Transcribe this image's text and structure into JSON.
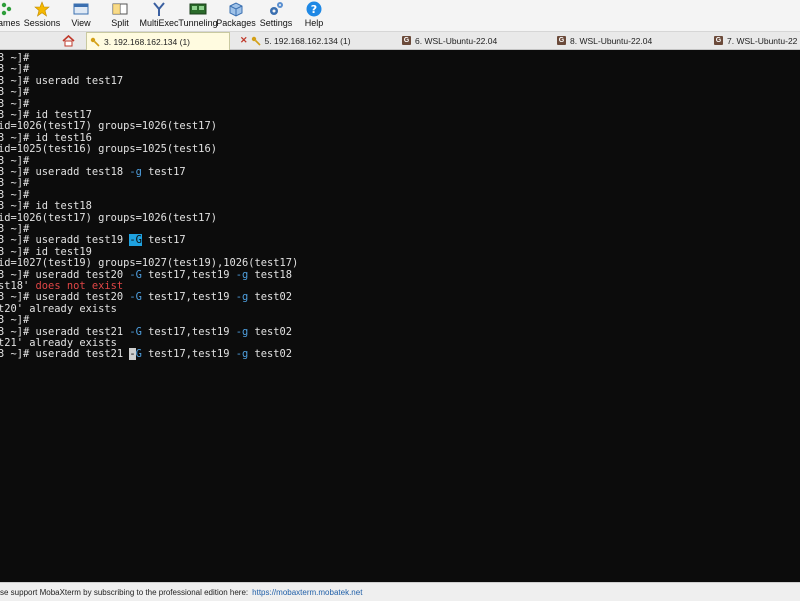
{
  "toolbar": {
    "items": [
      {
        "label": "ames",
        "icon": "games-icon"
      },
      {
        "label": "Sessions",
        "icon": "star-icon"
      },
      {
        "label": "View",
        "icon": "view-icon"
      },
      {
        "label": "Split",
        "icon": "split-icon"
      },
      {
        "label": "MultiExec",
        "icon": "multiexec-icon"
      },
      {
        "label": "Tunneling",
        "icon": "tunneling-icon"
      },
      {
        "label": "Packages",
        "icon": "packages-icon"
      },
      {
        "label": "Settings",
        "icon": "settings-icon"
      },
      {
        "label": "Help",
        "icon": "help-icon"
      }
    ]
  },
  "tabs": [
    {
      "label": "3. 192.168.162.134 (1)",
      "active": true
    },
    {
      "label": "5. 192.168.162.134 (1)",
      "active": false
    },
    {
      "label": "6. WSL-Ubuntu-22.04",
      "active": false
    },
    {
      "label": "8. WSL-Ubuntu-22.04",
      "active": false
    },
    {
      "label": "7. WSL-Ubuntu-22",
      "active": false
    }
  ],
  "terminal": {
    "lines": [
      [
        [
          "3 ~]#",
          ""
        ]
      ],
      [
        [
          "3 ~]#",
          ""
        ]
      ],
      [
        [
          "3 ~]# useradd test17",
          ""
        ]
      ],
      [
        [
          "3 ~]#",
          ""
        ]
      ],
      [
        [
          "3 ~]#",
          ""
        ]
      ],
      [
        [
          "3 ~]# id test17",
          ""
        ]
      ],
      [
        [
          "id=1026(test17) groups=1026(test17)",
          ""
        ]
      ],
      [
        [
          "3 ~]# id test16",
          ""
        ]
      ],
      [
        [
          "id=1025(test16) groups=1025(test16)",
          ""
        ]
      ],
      [
        [
          "3 ~]#",
          ""
        ]
      ],
      [
        [
          "3 ~]# useradd test18 ",
          ""
        ],
        [
          "-g",
          "opt"
        ],
        [
          " test17",
          ""
        ]
      ],
      [
        [
          "3 ~]#",
          ""
        ]
      ],
      [
        [
          "3 ~]#",
          ""
        ]
      ],
      [
        [
          "3 ~]# id test18",
          ""
        ]
      ],
      [
        [
          "id=1026(test17) groups=1026(test17)",
          ""
        ]
      ],
      [
        [
          "3 ~]#",
          ""
        ]
      ],
      [
        [
          "3 ~]# useradd test19 ",
          ""
        ],
        [
          "-G",
          "hl"
        ],
        [
          " test17",
          ""
        ]
      ],
      [
        [
          "3 ~]# id test19",
          ""
        ]
      ],
      [
        [
          "id=1027(test19) groups=1027(test19),1026(test17)",
          ""
        ]
      ],
      [
        [
          "3 ~]# useradd test20 ",
          ""
        ],
        [
          "-G",
          "opt"
        ],
        [
          " test17,test19 ",
          ""
        ],
        [
          "-g",
          "opt"
        ],
        [
          " test18",
          ""
        ]
      ],
      [
        [
          "st18' ",
          ""
        ],
        [
          "does not exist",
          "err"
        ]
      ],
      [
        [
          "3 ~]# useradd test20 ",
          ""
        ],
        [
          "-G",
          "opt"
        ],
        [
          " test17,test19 ",
          ""
        ],
        [
          "-g",
          "opt"
        ],
        [
          " test02",
          ""
        ]
      ],
      [
        [
          "t20' already exists",
          ""
        ]
      ],
      [
        [
          "3 ~]#",
          ""
        ]
      ],
      [
        [
          "3 ~]# useradd test21 ",
          ""
        ],
        [
          "-G",
          "opt"
        ],
        [
          " test17,test19 ",
          ""
        ],
        [
          "-g",
          "opt"
        ],
        [
          " test02",
          ""
        ]
      ],
      [
        [
          "t21' already exists",
          ""
        ]
      ],
      [
        [
          "3 ~]# useradd test21 ",
          ""
        ],
        [
          "-",
          "cursor"
        ],
        [
          "G",
          "opt"
        ],
        [
          " test17,test19 ",
          ""
        ],
        [
          "-g",
          "opt"
        ],
        [
          " test02",
          ""
        ]
      ]
    ]
  },
  "statusbar": {
    "message": "se support MobaXterm by subscribing to the professional edition here:",
    "link": "https://mobaxterm.mobatek.net"
  },
  "colors": {
    "terminal_bg": "#0c0c0c",
    "terminal_fg": "#e2e2e2",
    "option_blue": "#4fa0e0",
    "error_red": "#e04646",
    "highlight": "#1fa2e0"
  }
}
